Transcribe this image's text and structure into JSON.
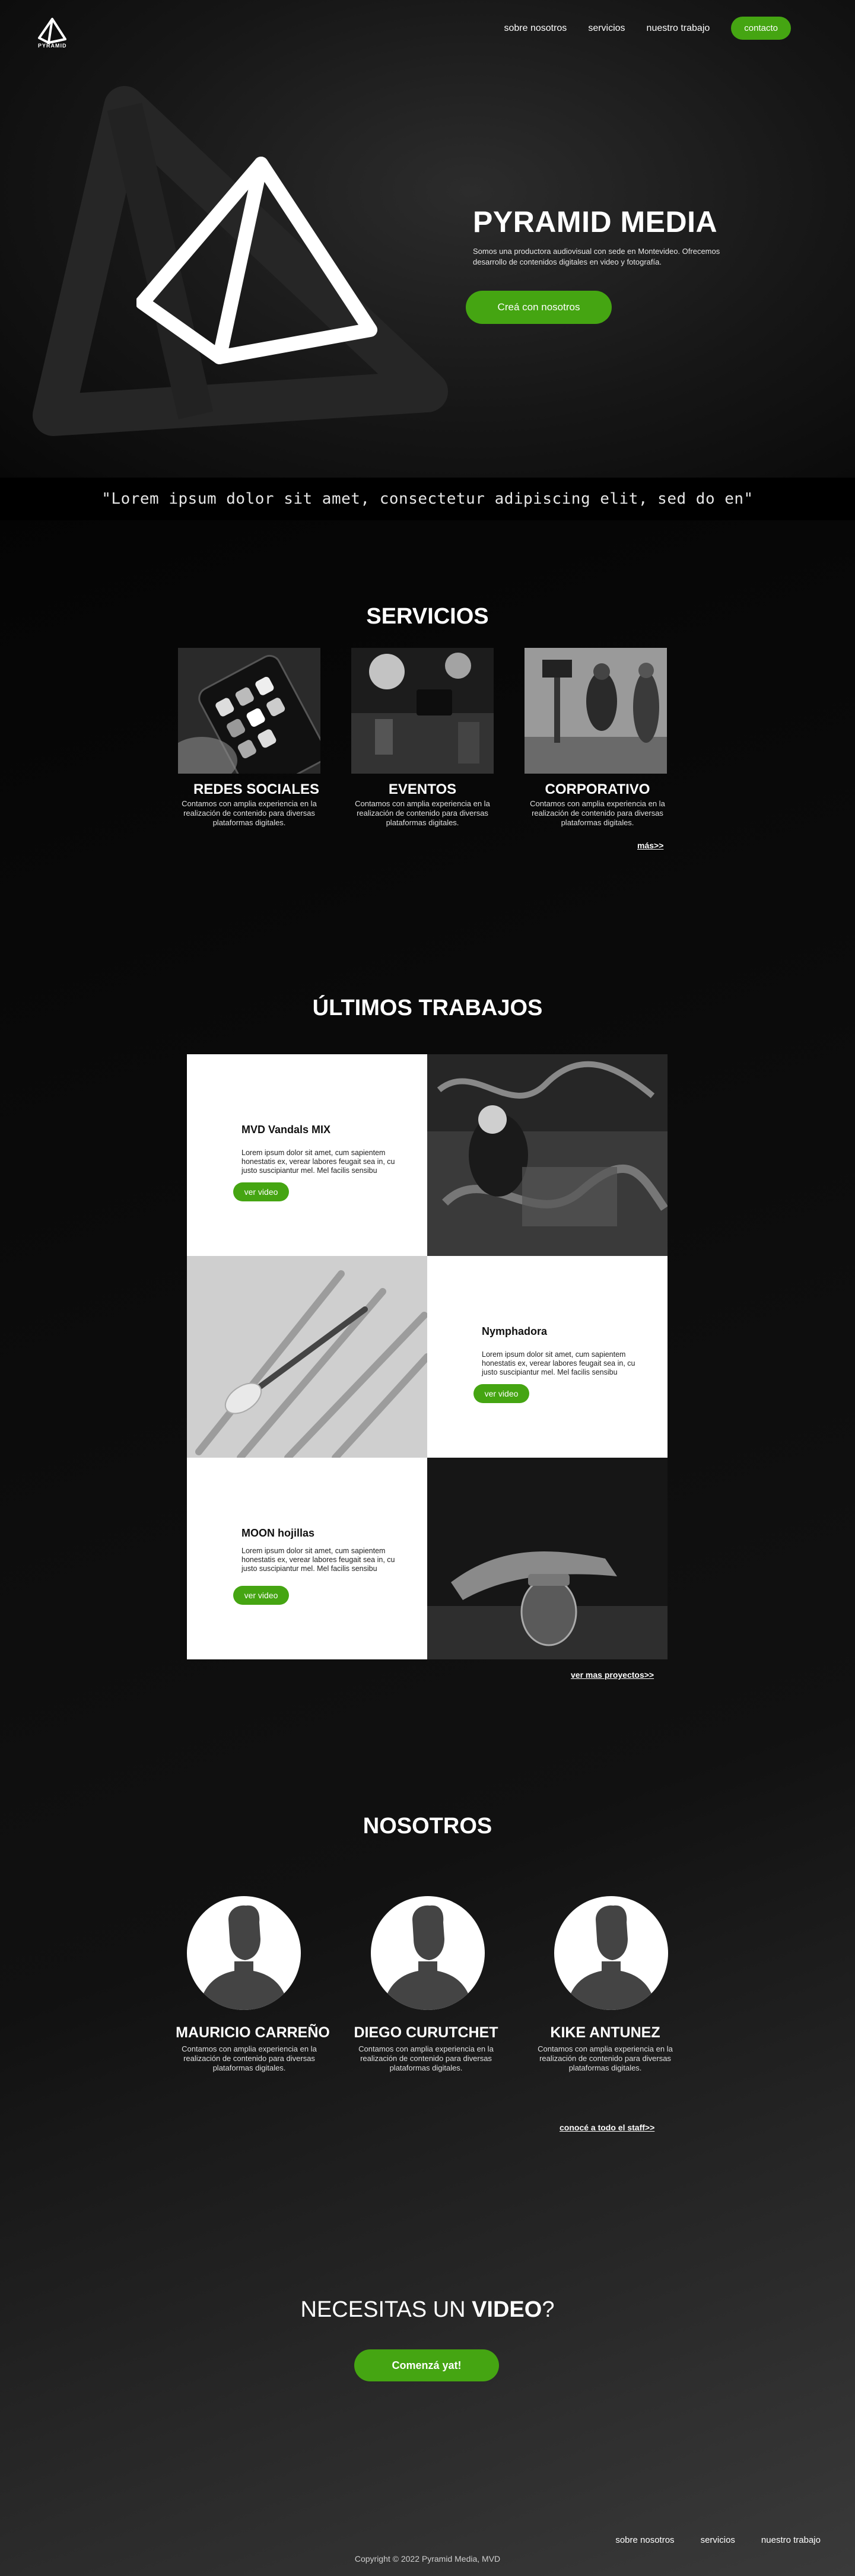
{
  "header": {
    "logo_text": "PYRAMID",
    "nav": [
      "sobre nosotros",
      "servicios",
      "nuestro trabajo"
    ],
    "contact_label": "contacto"
  },
  "hero": {
    "title": "PYRAMID MEDIA",
    "subtitle": "Somos una productora audiovisual con sede en Montevideo. Ofrecemos desarrollo de contenidos digitales en video y fotografía.",
    "cta": "Creá con nosotros"
  },
  "quote": "\"Lorem ipsum dolor sit amet, consectetur adipiscing elit, sed do en\"",
  "servicios": {
    "title": "SERVICIOS",
    "items": [
      {
        "name": "REDES SOCIALES",
        "desc": "Contamos con amplia experiencia en la realización de contenido para diversas plataformas digitales."
      },
      {
        "name": "EVENTOS",
        "desc": "Contamos con amplia experiencia en la realización de contenido para diversas plataformas digitales."
      },
      {
        "name": "CORPORATIVO",
        "desc": "Contamos con amplia experiencia en la realización de contenido para diversas plataformas digitales."
      }
    ],
    "more": "más>>"
  },
  "trabajos": {
    "title": "ÚLTIMOS TRABAJOS",
    "items": [
      {
        "title": "MVD Vandals MIX",
        "desc": "Lorem ipsum dolor sit amet, cum sapientem honestatis ex, verear labores feugait sea in, cu justo suscipiantur mel. Mel facilis sensibu",
        "button": "ver video"
      },
      {
        "title": "Nymphadora",
        "desc": "Lorem ipsum dolor sit amet, cum sapientem honestatis ex, verear labores feugait sea in, cu justo suscipiantur mel. Mel facilis sensibu",
        "button": "ver video"
      },
      {
        "title": "MOON hojillas",
        "desc": "Lorem ipsum dolor sit amet, cum sapientem honestatis ex, verear labores feugait sea in, cu justo suscipiantur mel. Mel facilis sensibu",
        "button": "ver video"
      }
    ],
    "more": "ver mas proyectos>>"
  },
  "nosotros": {
    "title": "NOSOTROS",
    "members": [
      {
        "name": "MAURICIO CARREÑO",
        "desc": "Contamos con amplia experiencia en la realización de contenido para diversas plataformas digitales."
      },
      {
        "name": "DIEGO CURUTCHET",
        "desc": "Contamos con amplia experiencia en la realización de contenido para diversas plataformas digitales."
      },
      {
        "name": "KIKE ANTUNEZ",
        "desc": "Contamos con amplia experiencia en la realización de contenido para diversas plataformas digitales."
      }
    ],
    "more": "conocé a todo el staff>>"
  },
  "cta": {
    "title_light": "NECESITAS UN ",
    "title_bold": "VIDEO",
    "title_end": "?",
    "button": "Comenzá yat!"
  },
  "footer": {
    "nav": [
      "sobre nosotros",
      "servicios",
      "nuestro trabajo"
    ],
    "copyright": "Copyright © 2022 Pyramid Media, MVD"
  },
  "colors": {
    "accent": "#45a512",
    "background": "#0a0a0a"
  }
}
